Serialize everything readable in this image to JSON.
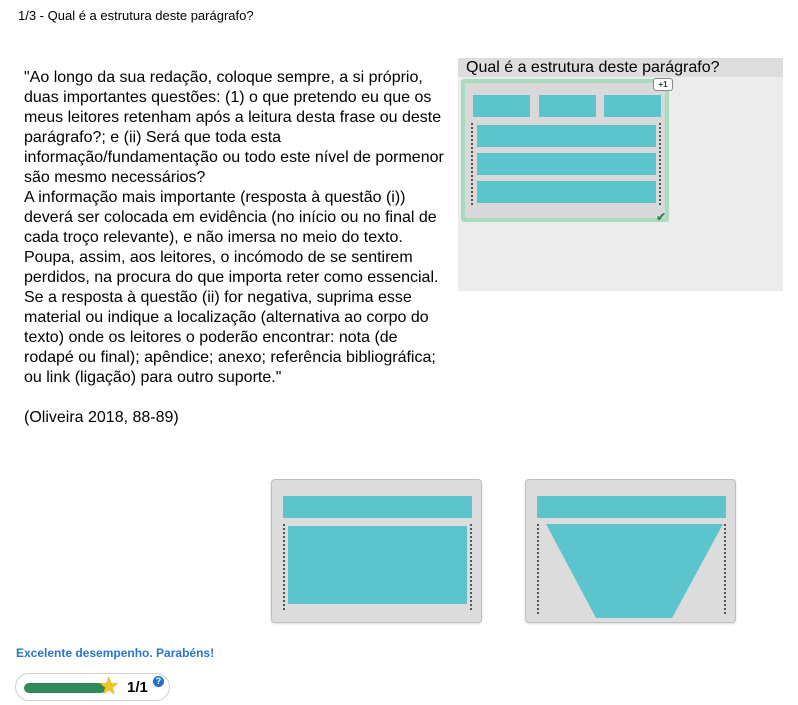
{
  "question": {
    "header": "1/3 - Qual é a estrutura deste parágrafo?"
  },
  "passage": {
    "text": "\"Ao longo da sua redação, coloque sempre, a si próprio, duas importantes questões: (1) o que pretendo eu que os meus leitores retenham após a leitura desta frase ou deste parágrafo?; e (ii) Será que toda esta informação/fundamentação ou todo este nível de pormenor são mesmo necessários?",
    "text2": "A informação mais importante (resposta à questão (i)) deverá ser colocada em evidência (no início ou no final de cada troço relevante), e não imersa no meio do texto. Poupa, assim, aos leitores, o incómodo de se sentirem perdidos, na procura do que importa reter como essencial. Se a resposta à questão (ii) for negativa, suprima esse material ou indique a localização (alternativa ao corpo do texto) onde os leitores o poderão encontrar: nota (de rodapé ou final); apêndice; anexo; referência bibliográfica; ou link (ligação) para outro suporte.\"",
    "citation": "(Oliveira 2018, 88-89)"
  },
  "drop_zone": {
    "title": "Qual é a estrutura deste parágrafo?",
    "badge": "+1",
    "check_icon": "checkmark-icon",
    "correct": true
  },
  "options": [
    {
      "name": "option-header-and-block"
    },
    {
      "name": "option-header-and-funnel"
    }
  ],
  "feedback": {
    "message": "Excelente desempenho. Parabéns!"
  },
  "score": {
    "progress": 1.0,
    "text": "1/1",
    "star_icon": "star-icon",
    "help_icon": "question-icon",
    "help_label": "?"
  },
  "colors": {
    "shape": "#5bc4cc",
    "correct_border": "#a8dcbc",
    "feedback": "#2a77c9",
    "progress": "#2f8b5a"
  }
}
